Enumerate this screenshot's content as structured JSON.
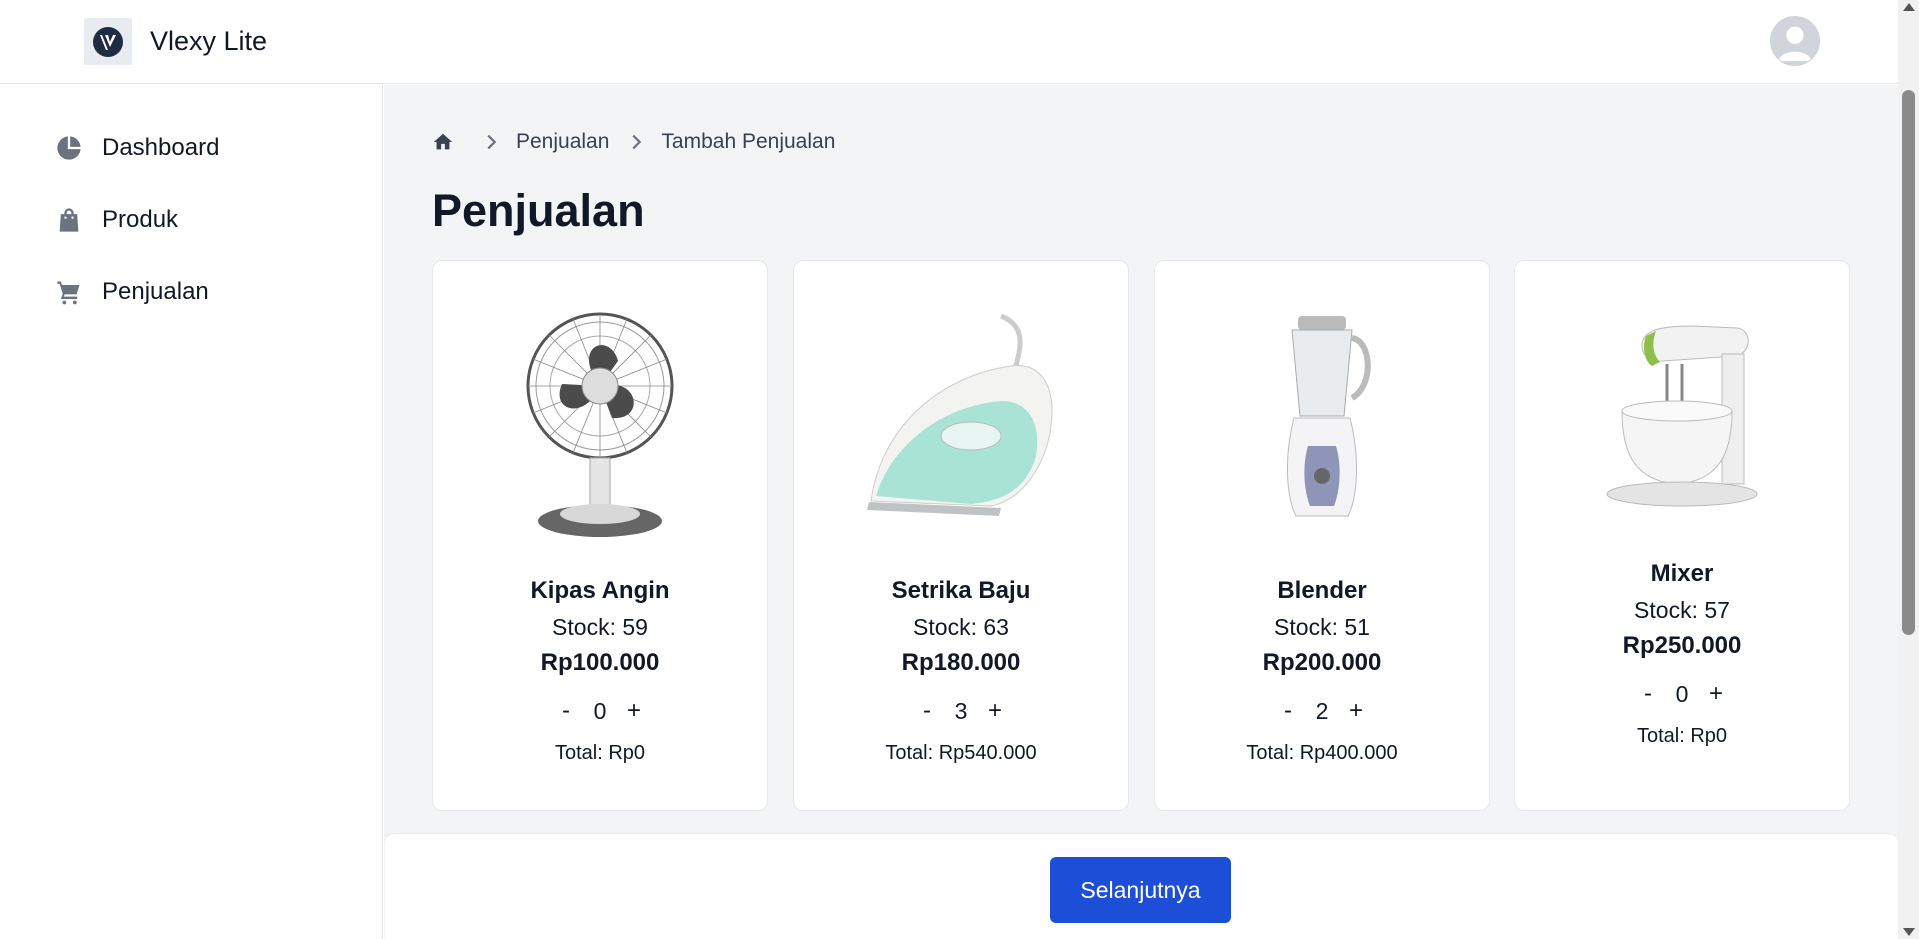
{
  "app": {
    "title": "Vlexy Lite",
    "logo_icon": "v-logo-icon",
    "avatar_icon": "user-avatar-icon"
  },
  "sidebar": {
    "items": [
      {
        "label": "Dashboard",
        "icon": "pie-chart-icon"
      },
      {
        "label": "Produk",
        "icon": "shopping-bag-icon"
      },
      {
        "label": "Penjualan",
        "icon": "shopping-cart-icon"
      }
    ]
  },
  "breadcrumb": {
    "home_icon": "home-icon",
    "items": [
      "Penjualan",
      "Tambah Penjualan"
    ]
  },
  "page": {
    "title": "Penjualan"
  },
  "products": [
    {
      "name": "Kipas Angin",
      "stock": "Stock: 59",
      "price": "Rp100.000",
      "minus": "-",
      "qty": "0",
      "plus": "+",
      "total": "Total: Rp0",
      "image": "fan-image"
    },
    {
      "name": "Setrika Baju",
      "stock": "Stock: 63",
      "price": "Rp180.000",
      "minus": "-",
      "qty": "3",
      "plus": "+",
      "total": "Total: Rp540.000",
      "image": "iron-image"
    },
    {
      "name": "Blender",
      "stock": "Stock: 51",
      "price": "Rp200.000",
      "minus": "-",
      "qty": "2",
      "plus": "+",
      "total": "Total: Rp400.000",
      "image": "blender-image"
    },
    {
      "name": "Mixer",
      "stock": "Stock: 57",
      "price": "Rp250.000",
      "minus": "-",
      "qty": "0",
      "plus": "+",
      "total": "Total: Rp0",
      "image": "mixer-image"
    }
  ],
  "footer": {
    "next_label": "Selanjutnya"
  },
  "colors": {
    "primary": "#1d4ed8",
    "background": "#f3f4f6",
    "icon_gray": "#6b7280",
    "text": "#111827"
  }
}
